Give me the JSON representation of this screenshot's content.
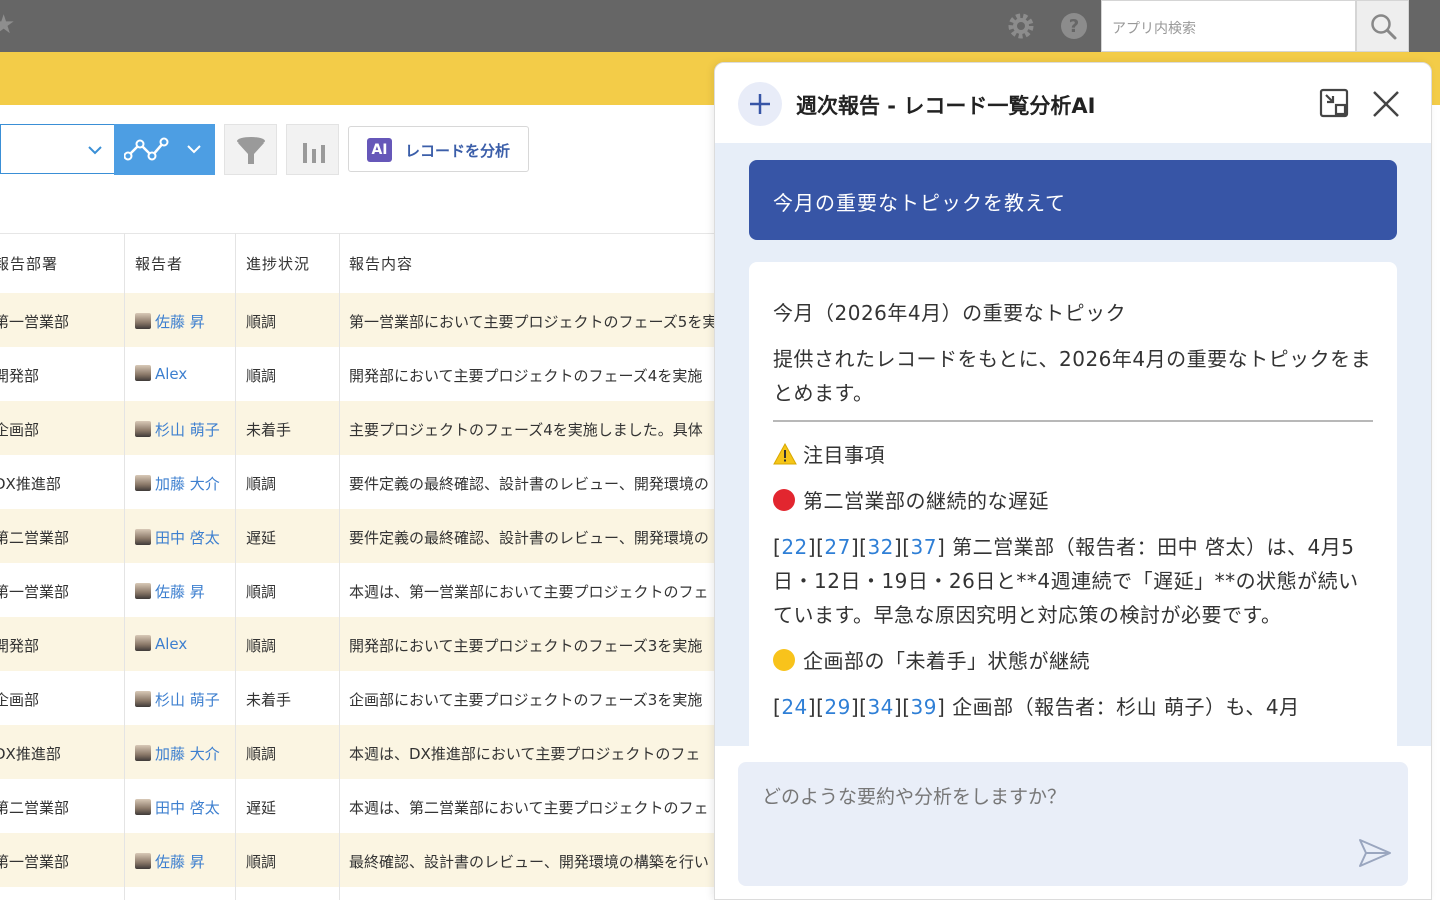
{
  "header": {
    "search_placeholder": "アプリ内検索",
    "icons": [
      "star-icon",
      "gear-icon",
      "help-icon",
      "search-icon"
    ]
  },
  "toolbar": {
    "analyze_badge": "AI",
    "analyze_label": "レコードを分析"
  },
  "table": {
    "columns": [
      "報告部署",
      "報告者",
      "進捗状況",
      "報告内容"
    ],
    "rows": [
      {
        "dept": "第一営業部",
        "user": "佐藤 昇",
        "status": "順調",
        "content": "第一営業部において主要プロジェクトのフェーズ5を実"
      },
      {
        "dept": "開発部",
        "user": "Alex",
        "status": "順調",
        "content": "開発部において主要プロジェクトのフェーズ4を実施"
      },
      {
        "dept": "企画部",
        "user": "杉山 萌子",
        "status": "未着手",
        "content": "主要プロジェクトのフェーズ4を実施しました。具体"
      },
      {
        "dept": "DX推進部",
        "user": "加藤 大介",
        "status": "順調",
        "content": "要件定義の最終確認、設計書のレビュー、開発環境の"
      },
      {
        "dept": "第二営業部",
        "user": "田中 啓太",
        "status": "遅延",
        "content": "要件定義の最終確認、設計書のレビュー、開発環境の"
      },
      {
        "dept": "第一営業部",
        "user": "佐藤 昇",
        "status": "順調",
        "content": "本週は、第一営業部において主要プロジェクトのフェ"
      },
      {
        "dept": "開発部",
        "user": "Alex",
        "status": "順調",
        "content": "開発部において主要プロジェクトのフェーズ3を実施"
      },
      {
        "dept": "企画部",
        "user": "杉山 萌子",
        "status": "未着手",
        "content": "企画部において主要プロジェクトのフェーズ3を実施"
      },
      {
        "dept": "DX推進部",
        "user": "加藤 大介",
        "status": "順調",
        "content": "本週は、DX推進部において主要プロジェクトのフェ"
      },
      {
        "dept": "第二営業部",
        "user": "田中 啓太",
        "status": "遅延",
        "content": "本週は、第二営業部において主要プロジェクトのフェ"
      },
      {
        "dept": "第一営業部",
        "user": "佐藤 昇",
        "status": "順調",
        "content": "最終確認、設計書のレビュー、開発環境の構築を行い"
      }
    ]
  },
  "panel": {
    "title": "週次報告 - レコード一覧分析AI",
    "user_message": "今月の重要なトピックを教えて",
    "ai": {
      "heading": "今月（2026年4月）の重要なトピック",
      "intro": "提供されたレコードをもとに、2026年4月の重要なトピックをまとめます。",
      "attention": "注目事項",
      "topic1_title": "第二営業部の継続的な遅延",
      "topic1_refs": [
        "22",
        "27",
        "32",
        "37"
      ],
      "topic1_body": "第二営業部（報告者：田中 啓太）は、4月5日・12日・19日・26日と**4週連続で「遅延」**の状態が続いています。早急な原因究明と対応策の検討が必要です。",
      "topic2_title": "企画部の「未着手」状態が継続",
      "topic2_refs": [
        "24",
        "29",
        "34",
        "39"
      ],
      "topic2_body": "企画部（報告者：杉山 萌子）も、4月"
    },
    "input_placeholder": "どのような要約や分析をしますか？"
  }
}
